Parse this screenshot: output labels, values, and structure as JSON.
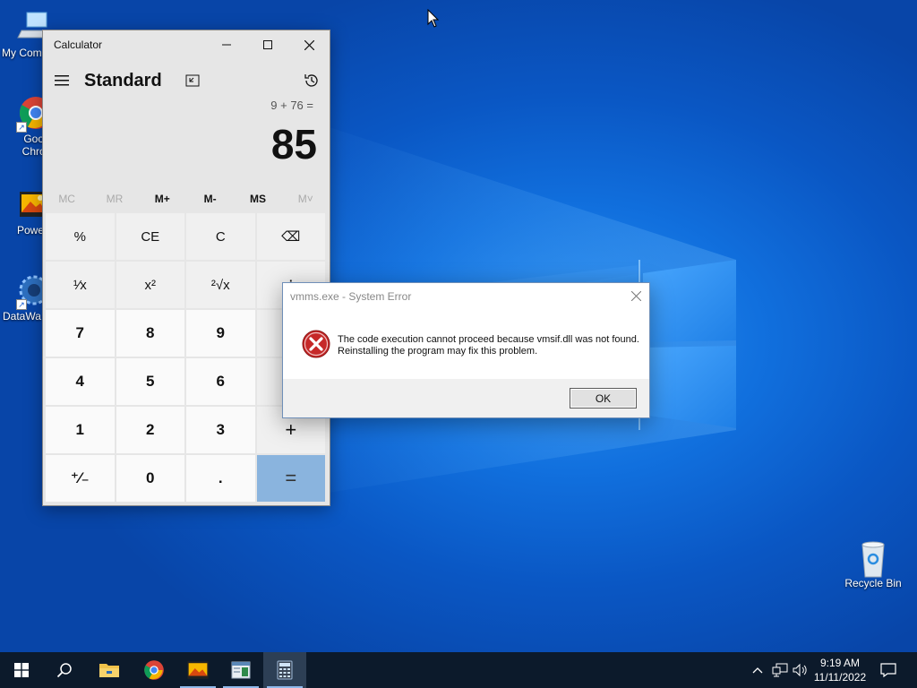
{
  "desktop": {
    "icons": [
      {
        "label": "My Com",
        "name": "my-computer"
      },
      {
        "label": "Goog\nChron",
        "name": "google-chrome"
      },
      {
        "label": "Powe",
        "name": "powerpoint-like"
      },
      {
        "label": "DataWa",
        "name": "datawagon"
      },
      {
        "label": "Recycle Bin",
        "name": "recycle-bin"
      }
    ]
  },
  "calculator": {
    "window_title": "Calculator",
    "mode": "Standard",
    "expression": "9 + 76 =",
    "result": "85",
    "memory": [
      "MC",
      "MR",
      "M+",
      "M-",
      "MS",
      "M˅"
    ],
    "keys": [
      {
        "label": "%",
        "kind": "fn",
        "name": "percent-key"
      },
      {
        "label": "CE",
        "kind": "fn",
        "name": "clear-entry-key"
      },
      {
        "label": "C",
        "kind": "fn",
        "name": "clear-key"
      },
      {
        "label": "⌫",
        "kind": "fn",
        "name": "backspace-key"
      },
      {
        "label": "¹⁄x",
        "kind": "fn",
        "name": "reciprocal-key"
      },
      {
        "label": "x²",
        "kind": "fn",
        "name": "square-key"
      },
      {
        "label": "²√x",
        "kind": "fn",
        "name": "sqrt-key"
      },
      {
        "label": "÷",
        "kind": "op",
        "name": "divide-key"
      },
      {
        "label": "7",
        "kind": "num",
        "name": "digit-7-key"
      },
      {
        "label": "8",
        "kind": "num",
        "name": "digit-8-key"
      },
      {
        "label": "9",
        "kind": "num",
        "name": "digit-9-key"
      },
      {
        "label": "×",
        "kind": "op",
        "name": "multiply-key"
      },
      {
        "label": "4",
        "kind": "num",
        "name": "digit-4-key"
      },
      {
        "label": "5",
        "kind": "num",
        "name": "digit-5-key"
      },
      {
        "label": "6",
        "kind": "num",
        "name": "digit-6-key"
      },
      {
        "label": "−",
        "kind": "op",
        "name": "subtract-key"
      },
      {
        "label": "1",
        "kind": "num",
        "name": "digit-1-key"
      },
      {
        "label": "2",
        "kind": "num",
        "name": "digit-2-key"
      },
      {
        "label": "3",
        "kind": "num",
        "name": "digit-3-key"
      },
      {
        "label": "+",
        "kind": "op",
        "name": "add-key"
      },
      {
        "label": "⁺⁄₋",
        "kind": "num",
        "name": "negate-key"
      },
      {
        "label": "0",
        "kind": "num",
        "name": "digit-0-key"
      },
      {
        "label": ".",
        "kind": "num",
        "name": "decimal-key"
      },
      {
        "label": "=",
        "kind": "eq",
        "name": "equals-key"
      }
    ]
  },
  "dialog": {
    "title": "vmms.exe - System Error",
    "message": "The code execution cannot proceed because vmsif.dll was not found. Reinstalling the program may fix this problem.",
    "ok_label": "OK"
  },
  "taskbar": {
    "time": "9:19 AM",
    "date": "11/11/2022"
  },
  "colors": {
    "desktop_blue": "#0a5bc9",
    "taskbar": "#0c1a2b",
    "equals_key": "#8ab4de",
    "error_red": "#c62828"
  }
}
